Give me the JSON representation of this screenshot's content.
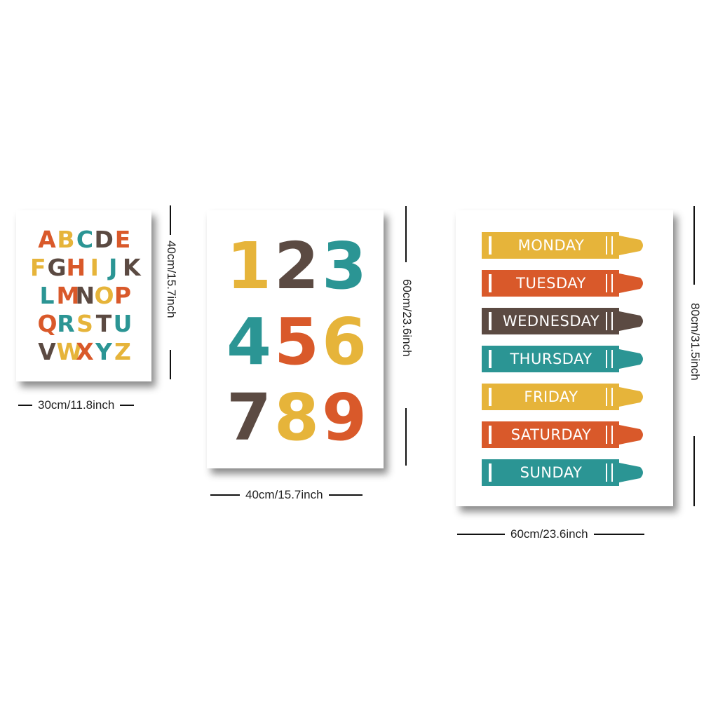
{
  "colors": {
    "orange": "#d9592a",
    "yellow": "#e6b43a",
    "teal": "#2b9594",
    "brown": "#5b4a42"
  },
  "alphabet_poster": {
    "rows": [
      [
        {
          "ch": "A",
          "c": "orange"
        },
        {
          "ch": "B",
          "c": "yellow"
        },
        {
          "ch": "C",
          "c": "teal"
        },
        {
          "ch": "D",
          "c": "brown"
        },
        {
          "ch": "E",
          "c": "orange"
        }
      ],
      [
        {
          "ch": "F",
          "c": "yellow"
        },
        {
          "ch": "G",
          "c": "brown"
        },
        {
          "ch": "H",
          "c": "orange"
        },
        {
          "ch": "I",
          "c": "yellow"
        },
        {
          "ch": "J",
          "c": "teal"
        },
        {
          "ch": "K",
          "c": "brown"
        }
      ],
      [
        {
          "ch": "L",
          "c": "teal"
        },
        {
          "ch": "M",
          "c": "orange"
        },
        {
          "ch": "N",
          "c": "brown"
        },
        {
          "ch": "O",
          "c": "yellow"
        },
        {
          "ch": "P",
          "c": "orange"
        }
      ],
      [
        {
          "ch": "Q",
          "c": "orange"
        },
        {
          "ch": "R",
          "c": "teal"
        },
        {
          "ch": "S",
          "c": "yellow"
        },
        {
          "ch": "T",
          "c": "brown"
        },
        {
          "ch": "U",
          "c": "teal"
        }
      ],
      [
        {
          "ch": "V",
          "c": "brown"
        },
        {
          "ch": "W",
          "c": "yellow"
        },
        {
          "ch": "X",
          "c": "orange"
        },
        {
          "ch": "Y",
          "c": "teal"
        },
        {
          "ch": "Z",
          "c": "yellow"
        }
      ]
    ],
    "width_label": "30cm/11.8inch",
    "height_label": "40cm/15.7inch"
  },
  "numbers_poster": {
    "rows": [
      [
        {
          "ch": "1",
          "c": "yellow"
        },
        {
          "ch": "2",
          "c": "brown"
        },
        {
          "ch": "3",
          "c": "teal"
        }
      ],
      [
        {
          "ch": "4",
          "c": "teal"
        },
        {
          "ch": "5",
          "c": "orange"
        },
        {
          "ch": "6",
          "c": "yellow"
        }
      ],
      [
        {
          "ch": "7",
          "c": "brown"
        },
        {
          "ch": "8",
          "c": "yellow"
        },
        {
          "ch": "9",
          "c": "orange"
        }
      ]
    ],
    "width_label": "40cm/15.7inch",
    "height_label": "60cm/23.6inch"
  },
  "days_poster": {
    "crayons": [
      {
        "label": "MONDAY",
        "c": "yellow"
      },
      {
        "label": "TUESDAY",
        "c": "orange"
      },
      {
        "label": "WEDNESDAY",
        "c": "brown"
      },
      {
        "label": "THURSDAY",
        "c": "teal"
      },
      {
        "label": "FRIDAY",
        "c": "yellow"
      },
      {
        "label": "SATURDAY",
        "c": "orange"
      },
      {
        "label": "SUNDAY",
        "c": "teal"
      }
    ],
    "width_label": "60cm/23.6inch",
    "height_label": "80cm/31.5inch"
  }
}
